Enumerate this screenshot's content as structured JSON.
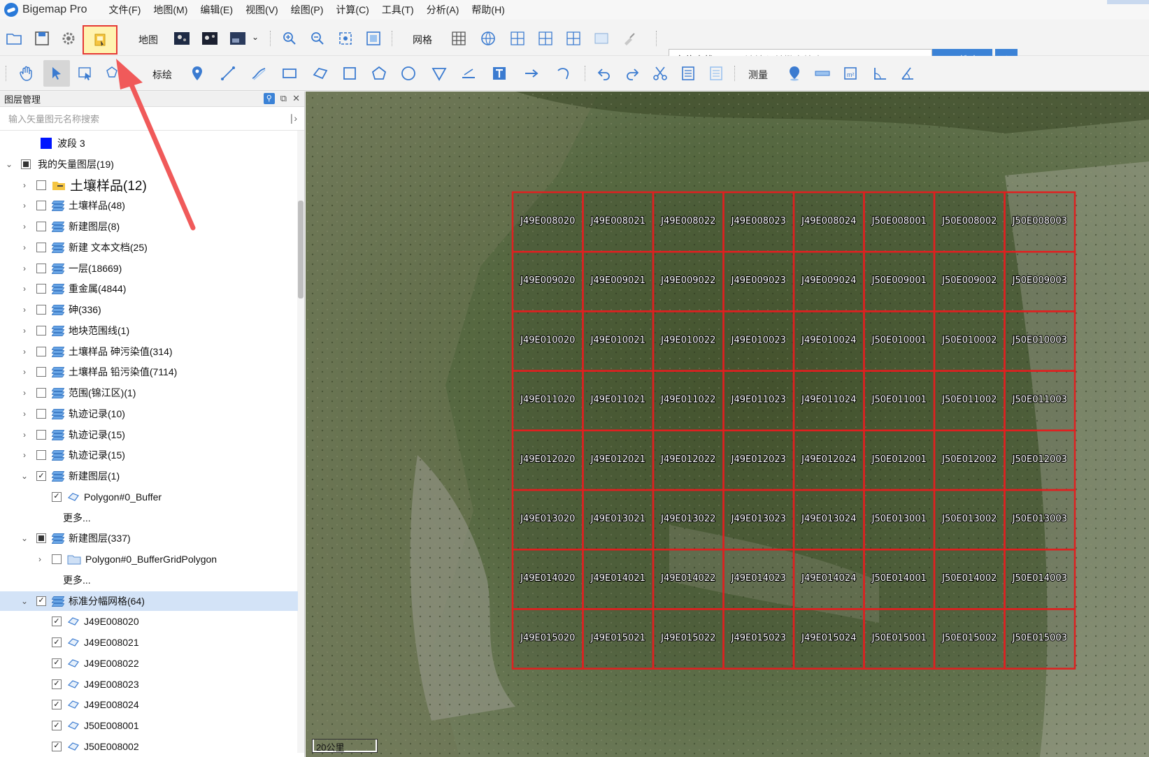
{
  "app": {
    "title": "Bigemap Pro"
  },
  "menu": [
    "文件(F)",
    "地图(M)",
    "编辑(E)",
    "视图(V)",
    "绘图(P)",
    "计算(C)",
    "工具(T)",
    "分析(A)",
    "帮助(H)"
  ],
  "toolbar1": {
    "map_label": "地图",
    "grid_label": "网格",
    "locate_select": "定位查找",
    "search_placeholder": "请输入关键字检索",
    "search_button": "搜索"
  },
  "toolbar2": {
    "annotate_label": "标绘",
    "measure_label": "测量"
  },
  "panel": {
    "title": "图层管理",
    "filter_placeholder": "输入矢量图元名称搜索",
    "rows": [
      {
        "label": "波段 3",
        "type": "band"
      },
      {
        "label": "我的矢量图层(19)",
        "type": "root"
      },
      {
        "label": "土壤样品(12)",
        "type": "folder"
      },
      {
        "label": "土壤样品(48)",
        "type": "layer"
      },
      {
        "label": "新建图层(8)",
        "type": "layer"
      },
      {
        "label": "新建 文本文档(25)",
        "type": "layer"
      },
      {
        "label": "一层(18669)",
        "type": "layer"
      },
      {
        "label": "重金属(4844)",
        "type": "layer"
      },
      {
        "label": "砷(336)",
        "type": "layer"
      },
      {
        "label": "地块范围线(1)",
        "type": "layer"
      },
      {
        "label": "土壤样品 砷污染值(314)",
        "type": "layer"
      },
      {
        "label": "土壤样品 铅污染值(7114)",
        "type": "layer"
      },
      {
        "label": "范围(锦江区)(1)",
        "type": "layer"
      },
      {
        "label": "轨迹记录(10)",
        "type": "layer"
      },
      {
        "label": "轨迹记录(15)",
        "type": "layer"
      },
      {
        "label": "轨迹记录(15)",
        "type": "layer"
      },
      {
        "label": "新建图层(1)",
        "type": "layer-open"
      },
      {
        "label": "Polygon#0_Buffer",
        "type": "poly"
      },
      {
        "label": "更多...",
        "type": "more"
      },
      {
        "label": "新建图层(337)",
        "type": "layer-open"
      },
      {
        "label": "Polygon#0_BufferGridPolygon",
        "type": "folder-sub"
      },
      {
        "label": "更多...",
        "type": "more"
      },
      {
        "label": "标准分幅网格(64)",
        "type": "layer-sel"
      },
      {
        "label": "J49E008020",
        "type": "poly"
      },
      {
        "label": "J49E008021",
        "type": "poly"
      },
      {
        "label": "J49E008022",
        "type": "poly"
      },
      {
        "label": "J49E008023",
        "type": "poly"
      },
      {
        "label": "J49E008024",
        "type": "poly"
      },
      {
        "label": "J50E008001",
        "type": "poly"
      },
      {
        "label": "J50E008002",
        "type": "poly"
      }
    ]
  },
  "map": {
    "grid_color": "#e02020",
    "grid_labels": [
      [
        "J49E008020",
        "J49E008021",
        "J49E008022",
        "J49E008023",
        "J49E008024",
        "J50E008001",
        "J50E008002",
        "J50E008003"
      ],
      [
        "J49E009020",
        "J49E009021",
        "J49E009022",
        "J49E009023",
        "J49E009024",
        "J50E009001",
        "J50E009002",
        "J50E009003"
      ],
      [
        "J49E010020",
        "J49E010021",
        "J49E010022",
        "J49E010023",
        "J49E010024",
        "J50E010001",
        "J50E010002",
        "J50E010003"
      ],
      [
        "J49E011020",
        "J49E011021",
        "J49E011022",
        "J49E011023",
        "J49E011024",
        "J50E011001",
        "J50E011002",
        "J50E011003"
      ],
      [
        "J49E012020",
        "J49E012021",
        "J49E012022",
        "J49E012023",
        "J49E012024",
        "J50E012001",
        "J50E012002",
        "J50E012003"
      ],
      [
        "J49E013020",
        "J49E013021",
        "J49E013022",
        "J49E013023",
        "J49E013024",
        "J50E013001",
        "J50E013002",
        "J50E013003"
      ],
      [
        "J49E014020",
        "J49E014021",
        "J49E014022",
        "J49E014023",
        "J49E014024",
        "J50E014001",
        "J50E014002",
        "J50E014003"
      ],
      [
        "J49E015020",
        "J49E015021",
        "J49E015022",
        "J49E015023",
        "J49E015024",
        "J50E015001",
        "J50E015002",
        "J50E015003"
      ]
    ],
    "scale_label": "20公里"
  }
}
